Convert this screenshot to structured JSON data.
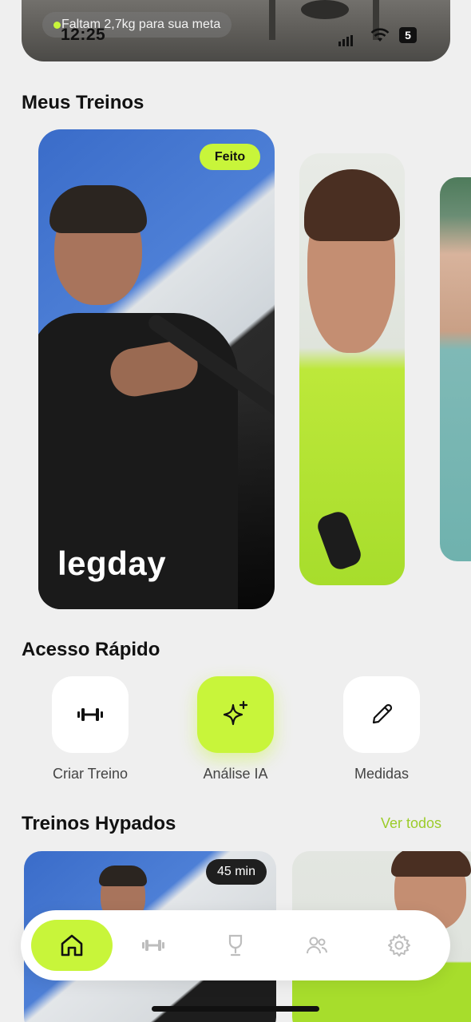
{
  "status_bar": {
    "time": "12:25",
    "battery": "5"
  },
  "hero": {
    "goal_text": "Faltam 2,7kg para sua meta"
  },
  "my_workouts": {
    "title": "Meus Treinos",
    "cards": [
      {
        "name": "legday",
        "badge": "Feito"
      }
    ]
  },
  "quick_access": {
    "title": "Acesso Rápido",
    "items": [
      {
        "label": "Criar Treino",
        "icon": "dumbbell-icon"
      },
      {
        "label": "Análise IA",
        "icon": "sparkle-icon"
      },
      {
        "label": "Medidas",
        "icon": "pencil-icon"
      }
    ]
  },
  "hyped": {
    "title": "Treinos Hypados",
    "see_all": "Ver todos",
    "cards": [
      {
        "duration": "45 min"
      }
    ]
  },
  "nav": {
    "items": [
      {
        "icon": "home-icon",
        "active": true
      },
      {
        "icon": "dumbbell-icon"
      },
      {
        "icon": "trophy-icon"
      },
      {
        "icon": "users-icon"
      },
      {
        "icon": "gear-icon"
      }
    ]
  },
  "colors": {
    "accent": "#c8f53a",
    "background": "#efefef",
    "accent_text": "#9ccc2a"
  }
}
